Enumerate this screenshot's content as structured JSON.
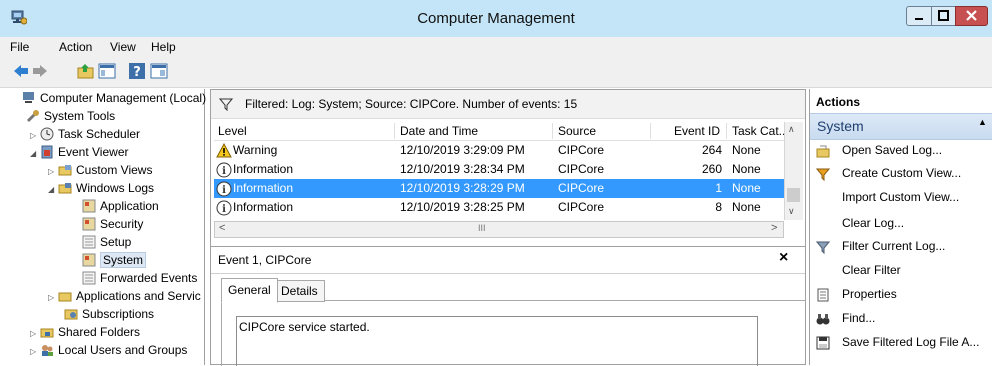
{
  "window": {
    "title": "Computer Management"
  },
  "menu": {
    "file": "File",
    "action": "Action",
    "view": "View",
    "help": "Help"
  },
  "tree": {
    "items": [
      {
        "label": "Computer Management (Local)"
      },
      {
        "label": "System Tools"
      },
      {
        "label": "Task Scheduler"
      },
      {
        "label": "Event Viewer"
      },
      {
        "label": "Custom Views"
      },
      {
        "label": "Windows Logs"
      },
      {
        "label": "Application"
      },
      {
        "label": "Security"
      },
      {
        "label": "Setup"
      },
      {
        "label": "System"
      },
      {
        "label": "Forwarded Events"
      },
      {
        "label": "Applications and Servic"
      },
      {
        "label": "Subscriptions"
      },
      {
        "label": "Shared Folders"
      },
      {
        "label": "Local Users and Groups"
      }
    ]
  },
  "filter": {
    "text": "Filtered: Log: System; Source: CIPCore. Number of events: 15"
  },
  "table": {
    "headers": {
      "level": "Level",
      "datetime": "Date and Time",
      "source": "Source",
      "eventid": "Event ID",
      "category": "Task Cat..."
    },
    "rows": [
      {
        "level": "Warning",
        "datetime": "12/10/2019 3:29:09 PM",
        "source": "CIPCore",
        "eventid": "264",
        "category": "None"
      },
      {
        "level": "Information",
        "datetime": "12/10/2019 3:28:34 PM",
        "source": "CIPCore",
        "eventid": "260",
        "category": "None"
      },
      {
        "level": "Information",
        "datetime": "12/10/2019 3:28:29 PM",
        "source": "CIPCore",
        "eventid": "1",
        "category": "None"
      },
      {
        "level": "Information",
        "datetime": "12/10/2019 3:28:25 PM",
        "source": "CIPCore",
        "eventid": "8",
        "category": "None"
      }
    ],
    "hscroll_thumb": "III"
  },
  "detail": {
    "title": "Event 1, CIPCore",
    "close": "×",
    "tabs": {
      "general": "General",
      "details": "Details"
    },
    "message": "CIPCore service started."
  },
  "actions": {
    "header": "Actions",
    "section": "System",
    "items": [
      "Open Saved Log...",
      "Create Custom View...",
      "Import Custom View...",
      "Clear Log...",
      "Filter Current Log...",
      "Clear Filter",
      "Properties",
      "Find...",
      "Save Filtered Log File A..."
    ]
  },
  "colors": {
    "titlebar": "#c4e5f7",
    "selection": "#3399ff",
    "close": "#c75050"
  }
}
